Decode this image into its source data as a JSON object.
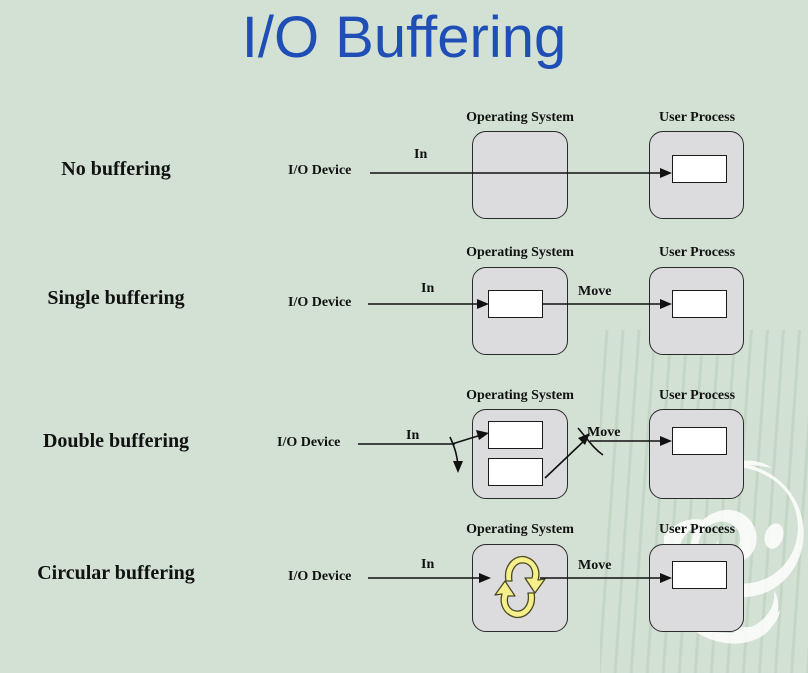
{
  "slide": {
    "title": "I/O Buffering",
    "title_color": "#1f4fb6",
    "background_color": "#d3e1d4",
    "container_fill": "#dcdcde",
    "buffer_fill": "#ffffff",
    "recycle_color": "#f6ef8a"
  },
  "common": {
    "os_caption": "Operating System",
    "user_caption": "User Process",
    "device_label": "I/O Device",
    "in_label": "In",
    "move_label": "Move"
  },
  "rows": [
    {
      "name": "no-buffering",
      "label": "No buffering",
      "device_label": "I/O Device",
      "in_label": "In",
      "move_label": "",
      "os_caption": "Operating System",
      "user_caption": "User Process",
      "os_buffers": 0,
      "user_buffers": 1
    },
    {
      "name": "single-buffering",
      "label": "Single buffering",
      "device_label": "I/O Device",
      "in_label": "In",
      "move_label": "Move",
      "os_caption": "Operating System",
      "user_caption": "User Process",
      "os_buffers": 1,
      "user_buffers": 1
    },
    {
      "name": "double-buffering",
      "label": "Double buffering",
      "device_label": "I/O Device",
      "in_label": "In",
      "move_label": "Move",
      "os_caption": "Operating System",
      "user_caption": "User Process",
      "os_buffers": 2,
      "user_buffers": 1
    },
    {
      "name": "circular-buffering",
      "label": "Circular buffering",
      "device_label": "I/O Device",
      "in_label": "In",
      "move_label": "Move",
      "os_caption": "Operating System",
      "user_caption": "User Process",
      "os_buffers": 0,
      "user_buffers": 1,
      "os_icon": "recycle-icon"
    }
  ]
}
